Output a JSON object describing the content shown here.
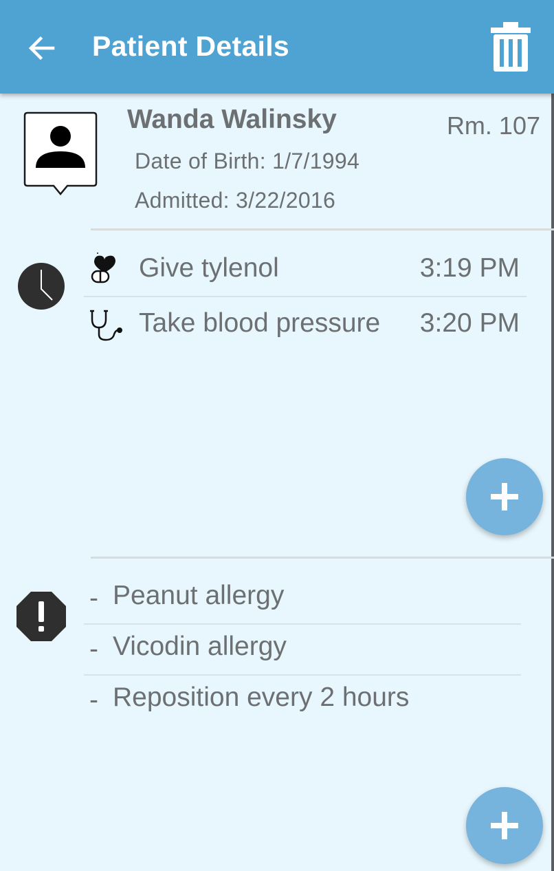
{
  "app_bar": {
    "title": "Patient Details",
    "back_icon": "arrow-left-icon",
    "delete_icon": "trash-icon",
    "bar_color": "#4fa3d3"
  },
  "patient": {
    "name": "Wanda Walinsky",
    "room": "Rm. 107",
    "dob": "Date of Birth: 1/7/1994",
    "admitted": "Admitted: 3/22/2016",
    "avatar_icon": "person-icon"
  },
  "tasks": {
    "section_icon": "clock-icon",
    "items": [
      {
        "label": "Give tylenol",
        "time": "3:19 PM",
        "icon": "medication-icon"
      },
      {
        "label": "Take blood pressure",
        "time": "3:20 PM",
        "icon": "stethoscope-icon"
      }
    ]
  },
  "notes": {
    "section_icon": "alert-icon",
    "bullet": "-",
    "items": [
      {
        "text": "Peanut allergy"
      },
      {
        "text": "Vicodin allergy"
      },
      {
        "text": "Reposition every 2 hours"
      }
    ]
  },
  "fab_icon": "plus-icon",
  "colors": {
    "background": "#e8f7fd",
    "text": "#6c7072",
    "fab": "#76b4dd"
  }
}
